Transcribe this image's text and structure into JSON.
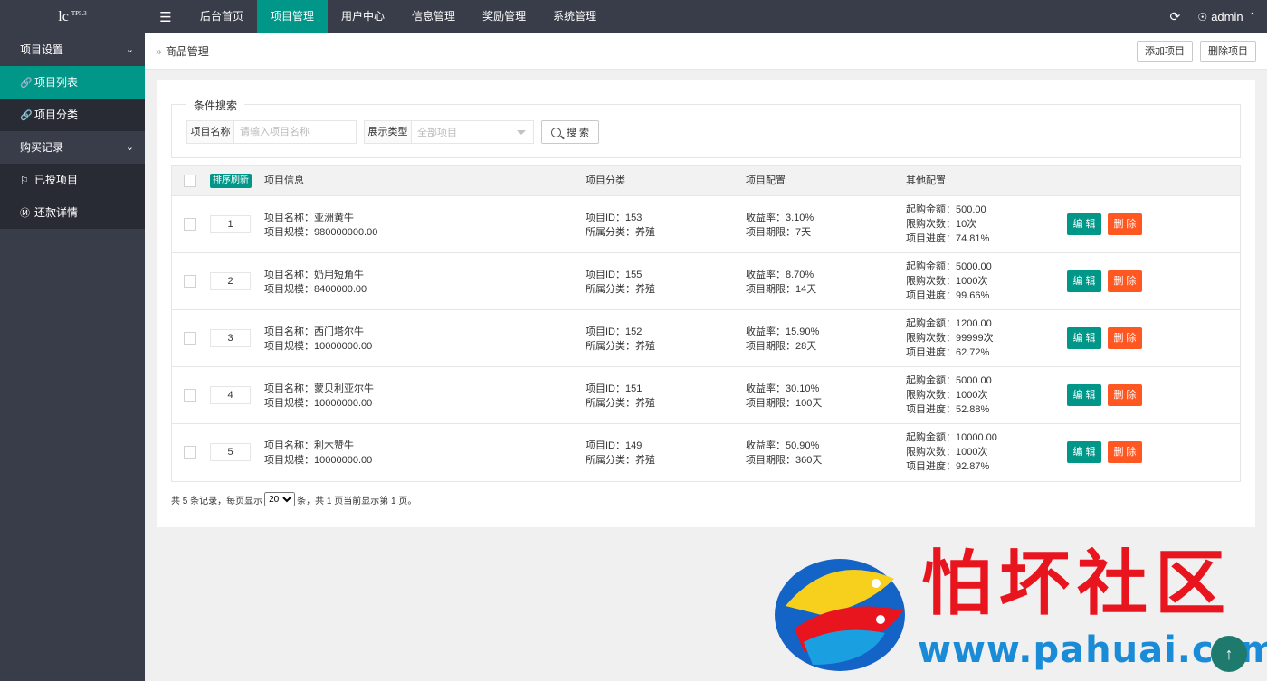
{
  "logo": {
    "text": "lc",
    "version": "TP5.3"
  },
  "topnav": [
    "后台首页",
    "项目管理",
    "用户中心",
    "信息管理",
    "奖励管理",
    "系统管理"
  ],
  "user": {
    "name": "admin"
  },
  "sidebar": {
    "group1": "项目设置",
    "item1": "项目列表",
    "item2": "项目分类",
    "group2": "购买记录",
    "item3": "已投项目",
    "item4": "还款详情"
  },
  "breadcrumb": "商品管理",
  "header_buttons": {
    "add": "添加项目",
    "delete": "删除项目"
  },
  "search": {
    "legend": "条件搜索",
    "name_label": "项目名称",
    "name_placeholder": "请输入项目名称",
    "type_label": "展示类型",
    "type_value": "全部项目",
    "button": "搜 索"
  },
  "table": {
    "sort_button": "排序刷新",
    "headers": {
      "info": "项目信息",
      "category": "项目分类",
      "config": "项目配置",
      "other": "其他配置"
    },
    "edit_label": "编 辑",
    "delete_label": "删 除",
    "rows": [
      {
        "sort": "1",
        "name": "项目名称：亚洲黄牛",
        "scale": "项目规模：980000000.00",
        "id": "项目ID：153",
        "cat": "所属分类：养殖",
        "rate": "收益率：3.10%",
        "period": "项目期限：7天",
        "min": "起购金额：500.00",
        "limit": "限购次数：10次",
        "progress": "项目进度：74.81%"
      },
      {
        "sort": "2",
        "name": "项目名称：奶用短角牛",
        "scale": "项目规模：8400000.00",
        "id": "项目ID：155",
        "cat": "所属分类：养殖",
        "rate": "收益率：8.70%",
        "period": "项目期限：14天",
        "min": "起购金额：5000.00",
        "limit": "限购次数：1000次",
        "progress": "项目进度：99.66%"
      },
      {
        "sort": "3",
        "name": "项目名称：西门塔尔牛",
        "scale": "项目规模：10000000.00",
        "id": "项目ID：152",
        "cat": "所属分类：养殖",
        "rate": "收益率：15.90%",
        "period": "项目期限：28天",
        "min": "起购金额：1200.00",
        "limit": "限购次数：99999次",
        "progress": "项目进度：62.72%"
      },
      {
        "sort": "4",
        "name": "项目名称：蒙贝利亚尔牛",
        "scale": "项目规模：10000000.00",
        "id": "项目ID：151",
        "cat": "所属分类：养殖",
        "rate": "收益率：30.10%",
        "period": "项目期限：100天",
        "min": "起购金额：5000.00",
        "limit": "限购次数：1000次",
        "progress": "项目进度：52.88%"
      },
      {
        "sort": "5",
        "name": "项目名称：利木赞牛",
        "scale": "项目规模：10000000.00",
        "id": "项目ID：149",
        "cat": "所属分类：养殖",
        "rate": "收益率：50.90%",
        "period": "项目期限：360天",
        "min": "起购金额：10000.00",
        "limit": "限购次数：1000次",
        "progress": "项目进度：92.87%"
      }
    ]
  },
  "pager": {
    "prefix": "共 5 条记录，每页显示",
    "page_size": "20",
    "suffix": "条，共 1 页当前显示第 1 页。"
  },
  "watermark": {
    "title": "怕坏社区",
    "url": "www.pahuai.com"
  }
}
